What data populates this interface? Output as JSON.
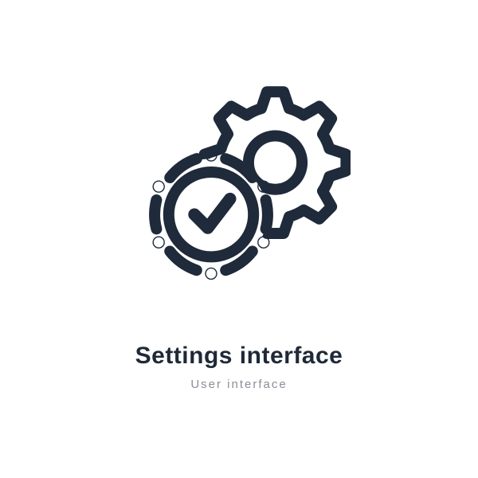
{
  "icon": {
    "name": "settings-interface-icon",
    "stroke_color": "#1f2a3a"
  },
  "title": "Settings interface",
  "subtitle": "User interface"
}
